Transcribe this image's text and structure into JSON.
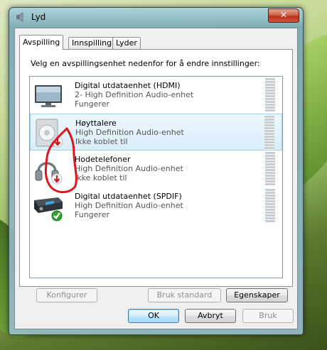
{
  "window": {
    "title": "Lyd",
    "close_label": "✕"
  },
  "tabs": [
    {
      "label": "Avspilling",
      "active": true
    },
    {
      "label": "Innspilling",
      "active": false
    },
    {
      "label": "Lyder",
      "active": false
    }
  ],
  "instruction": "Velg en avspillingsenhet nedenfor for å endre innstillinger:",
  "devices": [
    {
      "name": "Digital utdataenhet (HDMI)",
      "description": "2- High Definition Audio-enhet",
      "status": "Fungerer",
      "icon": "monitor-icon",
      "badge": "none",
      "selected": false
    },
    {
      "name": "Høyttalere",
      "description": "High Definition Audio-enhet",
      "status": "Ikke koblet til",
      "icon": "speaker-icon",
      "badge": "red-down-arrow",
      "selected": true
    },
    {
      "name": "Hodetelefoner",
      "description": "High Definition Audio-enhet",
      "status": "Ikke koblet til",
      "icon": "headphones-icon",
      "badge": "red-down-arrow",
      "selected": false
    },
    {
      "name": "Digital utdataenhet (SPDIF)",
      "description": "High Definition Audio-enhet",
      "status": "Fungerer",
      "icon": "receiver-icon",
      "badge": "green-check",
      "selected": false
    }
  ],
  "panel_buttons": {
    "configure": "Konfigurer",
    "set_default": "Bruk standard",
    "properties": "Egenskaper"
  },
  "dialog_buttons": {
    "ok": "OK",
    "cancel": "Avbryt",
    "apply": "Bruk"
  },
  "colors": {
    "selection_bg": "#d9eefb",
    "annotation_red": "#e0141c",
    "close_red": "#c8452e"
  }
}
